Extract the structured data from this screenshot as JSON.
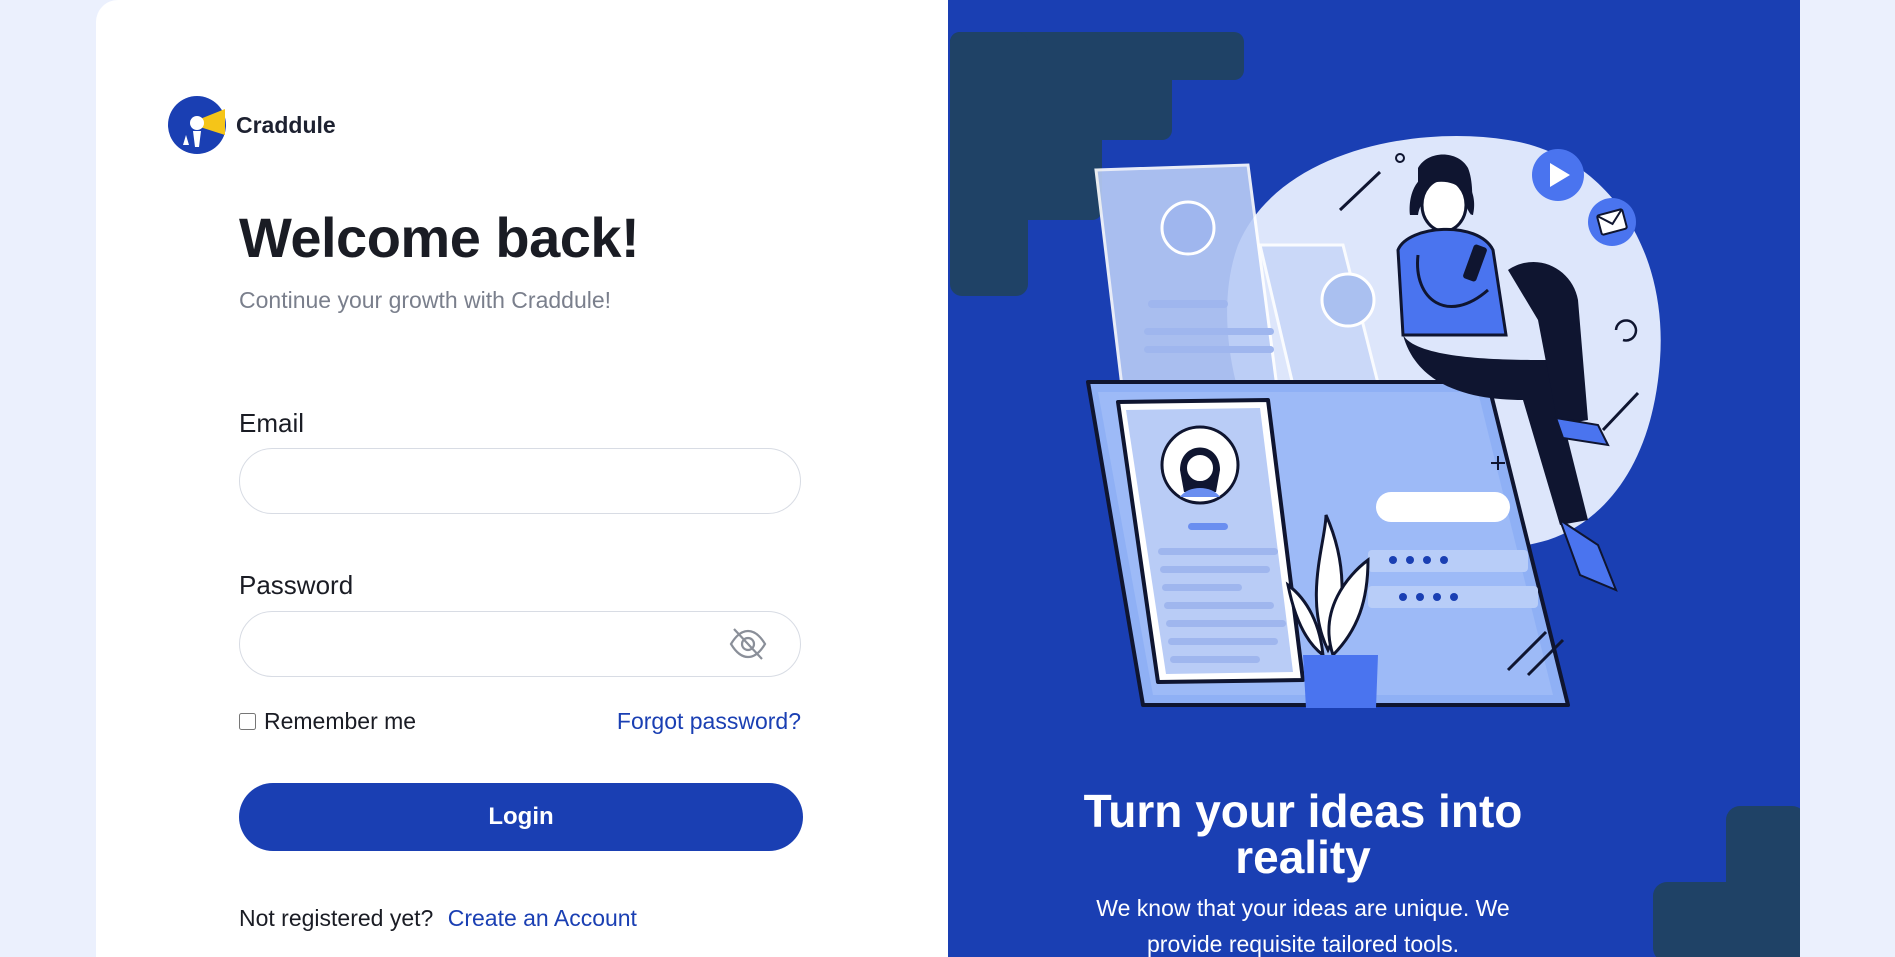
{
  "brand": {
    "name": "Craddule"
  },
  "login": {
    "title": "Welcome back!",
    "subtitle": "Continue your growth with Craddule!",
    "email_label": "Email",
    "email_value": "",
    "password_label": "Password",
    "password_value": "",
    "remember_label": "Remember me",
    "remember_checked": false,
    "forgot_label": "Forgot password?",
    "login_label": "Login",
    "register_prompt": "Not registered yet?",
    "register_link": "Create an Account"
  },
  "hero": {
    "title": "Turn your ideas into reality",
    "text": "We know that your ideas are unique. We provide requisite tailored tools."
  },
  "colors": {
    "primary": "#1a3fb3",
    "page_background": "#ebf0fd",
    "accent_yellow": "#f5c518",
    "decor_dark": "#1f4266"
  },
  "icons": {
    "logo": "craddule-logo-icon",
    "password_toggle": "eye-off-icon"
  }
}
